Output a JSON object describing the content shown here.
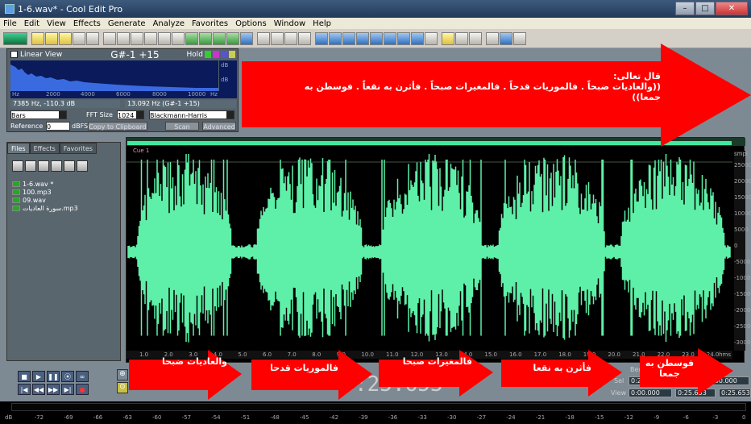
{
  "window": {
    "title": "1-6.wav* - Cool Edit Pro",
    "min": "–",
    "max": "□",
    "close": "✕"
  },
  "menu": [
    "File",
    "Edit",
    "View",
    "Effects",
    "Generate",
    "Analyze",
    "Favorites",
    "Options",
    "Window",
    "Help"
  ],
  "spectrum": {
    "linear_view": "Linear View",
    "note": "G#-1 +15",
    "hold": "Hold",
    "freq_ticks": [
      "Hz",
      "2000",
      "4000",
      "6000",
      "8000",
      "10000",
      "Hz"
    ],
    "db_label": "dB",
    "db_label2": "dB",
    "readout_left": "7385 Hz, -110.3 dB",
    "readout_right": "13.092 Hz (G#-1 +15)",
    "display_mode": "Bars",
    "fft_label": "FFT Size",
    "fft_size": "1024",
    "window_fn": "Blackmann-Harris",
    "reference_label": "Reference",
    "reference_value": "0",
    "dbfs": "dBFS",
    "copy_btn": "Copy to Clipboard",
    "scan_btn": "Scan",
    "advanced_btn": "Advanced"
  },
  "files_panel": {
    "tabs": [
      "Files",
      "Effects",
      "Favorites"
    ],
    "files": [
      "1-6.wav *",
      "100.mp3",
      "09.wav",
      "سورة العاديات.mp3"
    ]
  },
  "editor": {
    "cue_label": "Cue 1",
    "amp_unit": "smpl",
    "amp_ticks": [
      "25000",
      "20000",
      "15000",
      "10000",
      "5000",
      "0",
      "-5000",
      "-10000",
      "-15000",
      "-20000",
      "-25000",
      "-30000"
    ],
    "time_ticks": [
      "1.0",
      "2.0",
      "3.0",
      "4.0",
      "5.0",
      "6.0",
      "7.0",
      "8.0",
      "9.0",
      "10.0",
      "11.0",
      "12.0",
      "13.0",
      "14.0",
      "15.0",
      "16.0",
      "17.0",
      "18.0",
      "19.0",
      "20.0",
      "21.0",
      "22.0",
      "23.0",
      "24.0"
    ],
    "time_unit": "hms"
  },
  "transport": {
    "buttons": [
      "■",
      "▶",
      "❚❚",
      "⦿",
      "∞",
      "|◀",
      "◀◀",
      "▶▶",
      "▶|",
      "●"
    ]
  },
  "time_display": ":25.653",
  "selection": {
    "begin_label": "Begin",
    "sel_label": "Sel",
    "view_label": "View",
    "sel_begin": "0:25",
    "sel_end": "0:00.000",
    "view_begin": "0:00.000",
    "view_end": "0:25.653",
    "view_length": "0:25.653"
  },
  "meter_ticks": [
    "dB",
    "-72",
    "-69",
    "-66",
    "-63",
    "-60",
    "-57",
    "-54",
    "-51",
    "-48",
    "-45",
    "-42",
    "-39",
    "-36",
    "-33",
    "-30",
    "-27",
    "-24",
    "-21",
    "-18",
    "-15",
    "-12",
    "-9",
    "-6",
    "-3",
    "0"
  ],
  "annotations": {
    "top_line1": "قال تعالى:",
    "top_line2": "((والعاديات ضبحاً . فالموريات قدحاً . فالمغيرات صبحاً . فأثرن به نقعاً . فوسطن به",
    "top_line3": "جمعا))",
    "arrow1": "والعاديات ضبحا",
    "arrow2": "فالموريات قدحا",
    "arrow3": "فالمغيرات صبحا",
    "arrow4": "فأثرن به نقعا",
    "arrow5_l1": "فوسطن به",
    "arrow5_l2": "جمعا"
  },
  "colors": {
    "waveform": "#5ef0a8",
    "arrow": "#ff0000",
    "title_bg": "#2c4466",
    "panel": "#56626c"
  }
}
